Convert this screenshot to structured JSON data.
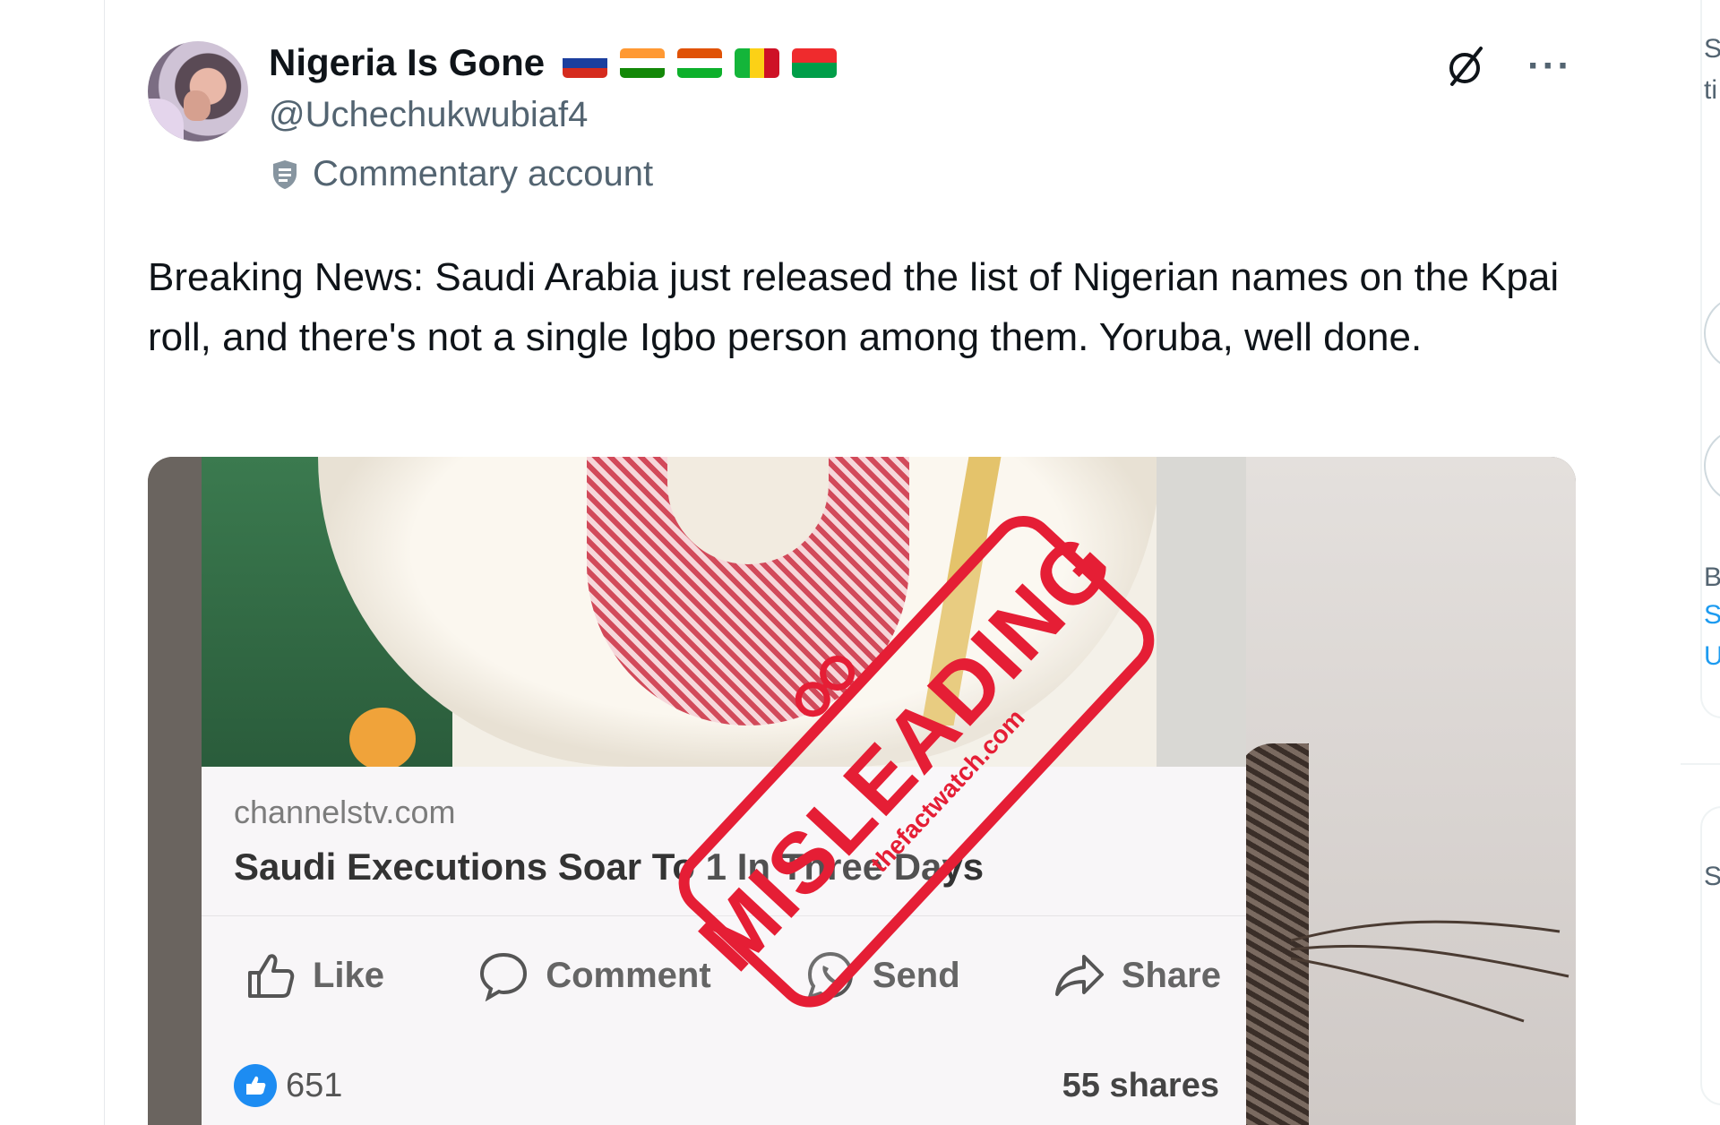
{
  "post": {
    "display_name": "Nigeria Is Gone",
    "flags": [
      {
        "name": "russia-flag",
        "colors": [
          "#ffffff",
          "#1c3f9e",
          "#d52b1e"
        ],
        "dir": "h"
      },
      {
        "name": "india-flag",
        "colors": [
          "#ff9933",
          "#ffffff",
          "#138808"
        ],
        "dir": "h"
      },
      {
        "name": "niger-flag",
        "colors": [
          "#e05206",
          "#ffffff",
          "#0db02b"
        ],
        "dir": "h"
      },
      {
        "name": "mali-flag",
        "colors": [
          "#14b53a",
          "#fcd116",
          "#ce1126"
        ],
        "dir": "v"
      },
      {
        "name": "burkina-faso-flag",
        "colors": [
          "#ef2b2d",
          "#009e49"
        ],
        "dir": "h"
      }
    ],
    "handle": "@Uchechukwubiaf4",
    "account_label": "Commentary account",
    "text": "Breaking News: Saudi Arabia just released the list of Nigerian names on the Kpai roll, and there's not a single Igbo person among them. Yoruba, well done."
  },
  "media": {
    "source_site": "channelstv.com",
    "headline": "Saudi Executions Soar To 1 In Three Days",
    "actions": {
      "like": "Like",
      "comment": "Comment",
      "send": "Send",
      "share": "Share"
    },
    "reaction_count": "651",
    "shares": "55 shares"
  },
  "stamp": {
    "verdict": "MISLEADING",
    "source": "thefactwatch.com",
    "color": "#e51e35"
  },
  "sidebar": {
    "text_1": "S",
    "text_2": "ti",
    "text_3": "B",
    "link_1": "S",
    "link_2": "U",
    "text_4": "S"
  },
  "colors": {
    "text_primary": "#0f1419",
    "text_secondary": "#536471",
    "accent": "#1d9bf0"
  }
}
